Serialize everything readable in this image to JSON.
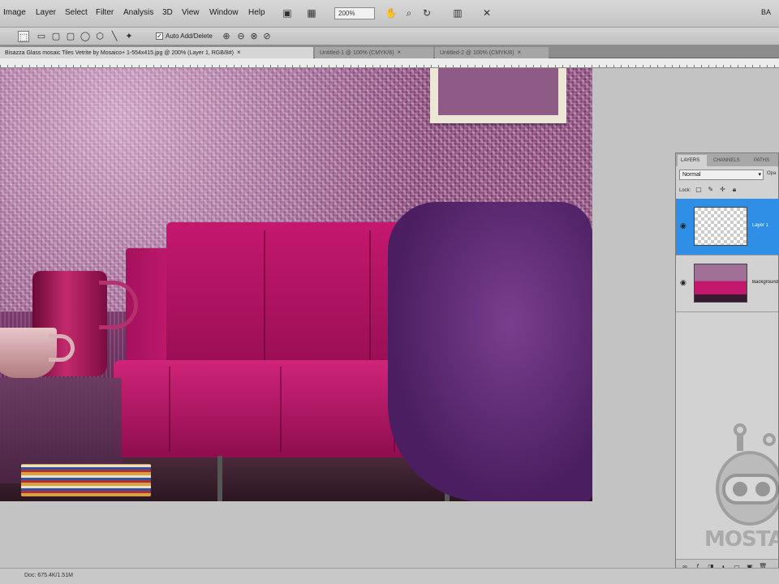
{
  "menu": {
    "items": [
      "Image",
      "Layer",
      "Select",
      "Filter",
      "Analysis",
      "3D",
      "View",
      "Window",
      "Help"
    ],
    "zoom": "200%",
    "workspace": "BA"
  },
  "icons": {
    "menubar": [
      "hand-icon",
      "zoom-icon",
      "rotate-icon",
      "arrange-icon",
      "screen-mode-icon"
    ],
    "options": [
      "selection-tool-icon",
      "rect-marquee-icon",
      "rounded-rect-icon",
      "ellipse-icon",
      "polygon-icon",
      "line-icon",
      "custom-shape-icon"
    ]
  },
  "options_bar": {
    "auto_add_delete_checked": true,
    "auto_add_delete_label": "Auto Add/Delete"
  },
  "tabs": [
    {
      "label": "Bisazza Glass mosaic Tiles Vetrite by Mosaico+ 1-554x415.jpg @ 200% (Layer 1, RGB/8#)",
      "active": true
    },
    {
      "label": "Untitled-1 @ 100% (CMYK/8)",
      "active": false
    },
    {
      "label": "Untitled-2 @ 100% (CMYK/8)",
      "active": false
    }
  ],
  "status": {
    "doc": "Doc: 675.4K/1.51M"
  },
  "layers_panel": {
    "tabs": [
      "LAYERS",
      "CHANNELS",
      "PATHS"
    ],
    "blend_mode": "Normal",
    "opacity_label": "Opa",
    "lock_label": "Lock:",
    "layers": [
      {
        "name": "Layer 1",
        "selected": true,
        "thumb": "transparent"
      },
      {
        "name": "Background",
        "selected": false,
        "thumb": "photo"
      }
    ]
  },
  "watermark": {
    "text": "MOSTA"
  }
}
